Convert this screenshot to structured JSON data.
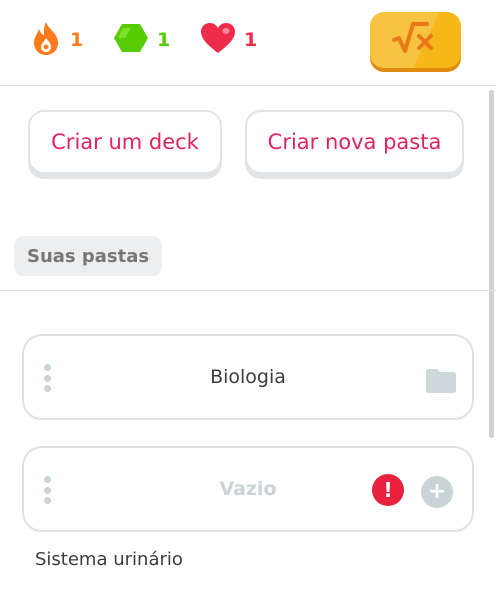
{
  "stats": {
    "streak": {
      "icon": "streak-flame-icon",
      "value": "1",
      "color": "#ff7a1a"
    },
    "gems": {
      "icon": "gem-icon",
      "value": "1",
      "color": "#58cc02"
    },
    "hearts": {
      "icon": "heart-icon",
      "value": "1",
      "color": "#ee2b4a"
    }
  },
  "calculator": {
    "icon": "square-root-icon",
    "color": "#f5b818"
  },
  "actions": {
    "create_deck": "Criar um deck",
    "create_folder": "Criar nova pasta",
    "accent_color": "#e0245e"
  },
  "section": {
    "title": "Suas pastas"
  },
  "folders": [
    {
      "name": "Biologia",
      "icon": "folder-icon"
    },
    {
      "name": "Vazio",
      "icons": [
        "alert-icon",
        "add-icon"
      ]
    }
  ],
  "next_item": {
    "label": "Sistema urinário"
  }
}
